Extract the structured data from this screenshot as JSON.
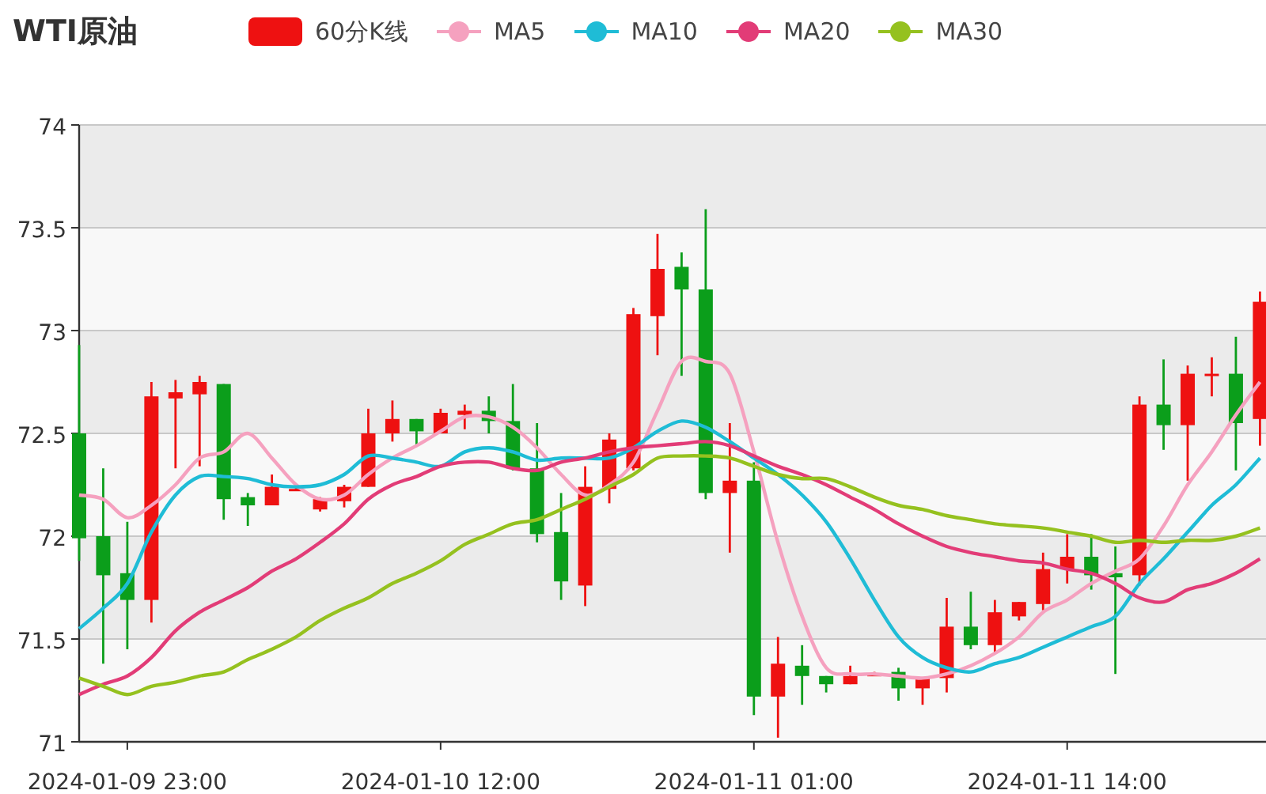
{
  "title": "WTI原油",
  "chart": {
    "candle_legend": {
      "label": "60分K线",
      "color": "#ee1111"
    },
    "candles": {
      "chart_data": {
        "type": "candlestick",
        "ylim": [
          71,
          74
        ],
        "grid": true,
        "yticks": [
          71,
          71.5,
          72,
          72.5,
          73,
          73.5,
          74
        ],
        "categories": [
          null,
          null,
          "2024-01-09 23:00",
          null,
          null,
          null,
          null,
          null,
          null,
          null,
          null,
          null,
          null,
          null,
          null,
          "2024-01-10 12:00",
          null,
          null,
          null,
          null,
          null,
          null,
          null,
          null,
          null,
          null,
          null,
          null,
          "2024-01-11 01:00",
          null,
          null,
          null,
          null,
          null,
          null,
          null,
          null,
          null,
          null,
          null,
          null,
          "2024-01-11 14:00",
          null,
          null,
          null,
          null,
          null,
          null,
          null,
          null
        ],
        "ohlc": [
          [
            72.5,
            72.93,
            71.88,
            71.99
          ],
          [
            72.0,
            72.33,
            71.38,
            71.81
          ],
          [
            71.82,
            72.07,
            71.45,
            71.69
          ],
          [
            71.69,
            72.75,
            71.58,
            72.68
          ],
          [
            72.67,
            72.76,
            72.33,
            72.7
          ],
          [
            72.69,
            72.78,
            72.34,
            72.75
          ],
          [
            72.74,
            72.74,
            72.08,
            72.18
          ],
          [
            72.19,
            72.21,
            72.05,
            72.15
          ],
          [
            72.15,
            72.3,
            72.15,
            72.24
          ],
          [
            72.23,
            72.24,
            72.22,
            72.23
          ],
          [
            72.13,
            72.19,
            72.12,
            72.18
          ],
          [
            72.17,
            72.25,
            72.14,
            72.24
          ],
          [
            72.24,
            72.62,
            72.24,
            72.5
          ],
          [
            72.5,
            72.66,
            72.46,
            72.57
          ],
          [
            72.57,
            72.57,
            72.44,
            72.51
          ],
          [
            72.5,
            72.62,
            72.5,
            72.6
          ],
          [
            72.59,
            72.64,
            72.52,
            72.61
          ],
          [
            72.61,
            72.68,
            72.5,
            72.56
          ],
          [
            72.56,
            72.74,
            72.32,
            72.33
          ],
          [
            72.33,
            72.55,
            71.97,
            72.01
          ],
          [
            72.02,
            72.21,
            71.69,
            71.78
          ],
          [
            71.76,
            72.34,
            71.66,
            72.24
          ],
          [
            72.23,
            72.5,
            72.16,
            72.47
          ],
          [
            72.33,
            73.11,
            72.32,
            73.08
          ],
          [
            73.07,
            73.47,
            72.88,
            73.3
          ],
          [
            73.31,
            73.38,
            72.78,
            73.2
          ],
          [
            73.2,
            73.59,
            72.18,
            72.21
          ],
          [
            72.21,
            72.55,
            71.92,
            72.27
          ],
          [
            72.27,
            72.36,
            71.13,
            71.22
          ],
          [
            71.22,
            71.51,
            71.02,
            71.38
          ],
          [
            71.37,
            71.47,
            71.18,
            71.32
          ],
          [
            71.32,
            71.32,
            71.24,
            71.28
          ],
          [
            71.28,
            71.37,
            71.28,
            71.32
          ],
          [
            71.33,
            71.34,
            71.32,
            71.33
          ],
          [
            71.34,
            71.36,
            71.2,
            71.26
          ],
          [
            71.26,
            71.31,
            71.18,
            71.31
          ],
          [
            71.31,
            71.7,
            71.24,
            71.56
          ],
          [
            71.56,
            71.73,
            71.45,
            71.47
          ],
          [
            71.47,
            71.69,
            71.43,
            71.63
          ],
          [
            71.61,
            71.68,
            71.59,
            71.68
          ],
          [
            71.67,
            71.92,
            71.64,
            71.84
          ],
          [
            71.84,
            72.01,
            71.77,
            71.9
          ],
          [
            71.9,
            72.01,
            71.74,
            71.81
          ],
          [
            71.82,
            71.95,
            71.33,
            71.8
          ],
          [
            71.81,
            72.68,
            71.76,
            72.64
          ],
          [
            72.64,
            72.86,
            72.42,
            72.54
          ],
          [
            72.54,
            72.83,
            72.27,
            72.79
          ],
          [
            72.79,
            72.87,
            72.68,
            72.79
          ],
          [
            72.79,
            72.97,
            72.32,
            72.55
          ],
          [
            72.57,
            73.19,
            72.44,
            73.14
          ]
        ]
      }
    },
    "moving_averages": {
      "chart_data": {
        "type": "line",
        "ylim": [
          71,
          74
        ],
        "series": [
          {
            "name": "MA5",
            "color": "#f5a1bf",
            "values": [
              72.2,
              72.18,
              72.09,
              72.15,
              72.25,
              72.38,
              72.41,
              72.5,
              72.38,
              72.25,
              72.18,
              72.2,
              72.3,
              72.38,
              72.44,
              72.51,
              72.58,
              72.58,
              72.53,
              72.43,
              72.3,
              72.2,
              72.25,
              72.36,
              72.61,
              72.85,
              72.85,
              72.79,
              72.41,
              71.97,
              71.61,
              71.36,
              71.33,
              71.33,
              71.32,
              71.31,
              71.33,
              71.37,
              71.43,
              71.51,
              71.63,
              71.69,
              71.77,
              71.83,
              71.89,
              72.05,
              72.25,
              72.41,
              72.59,
              72.75
            ]
          },
          {
            "name": "MA10",
            "color": "#1fbcd6",
            "values": [
              71.55,
              71.65,
              71.77,
              72.02,
              72.2,
              72.29,
              72.29,
              72.28,
              72.25,
              72.24,
              72.25,
              72.3,
              72.39,
              72.38,
              72.36,
              72.34,
              72.41,
              72.43,
              72.41,
              72.37,
              72.38,
              72.38,
              72.38,
              72.43,
              72.51,
              72.56,
              72.53,
              72.46,
              72.38,
              72.3,
              72.2,
              72.07,
              71.89,
              71.69,
              71.51,
              71.41,
              71.36,
              71.34,
              71.38,
              71.41,
              71.46,
              71.51,
              71.56,
              71.61,
              71.77,
              71.89,
              72.02,
              72.15,
              72.25,
              72.38
            ]
          },
          {
            "name": "MA20",
            "color": "#e23c77",
            "values": [
              71.23,
              71.28,
              71.32,
              71.41,
              71.54,
              71.63,
              71.69,
              71.75,
              71.83,
              71.89,
              71.97,
              72.06,
              72.18,
              72.25,
              72.29,
              72.34,
              72.36,
              72.36,
              72.33,
              72.32,
              72.36,
              72.38,
              72.41,
              72.43,
              72.44,
              72.45,
              72.46,
              72.44,
              72.39,
              72.34,
              72.3,
              72.25,
              72.19,
              72.13,
              72.06,
              72.0,
              71.95,
              71.92,
              71.9,
              71.88,
              71.87,
              71.84,
              71.82,
              71.77,
              71.7,
              71.68,
              71.74,
              71.77,
              71.82,
              71.89
            ]
          },
          {
            "name": "MA30",
            "color": "#95c11f",
            "values": [
              71.31,
              71.27,
              71.23,
              71.27,
              71.29,
              71.32,
              71.34,
              71.4,
              71.45,
              71.51,
              71.59,
              71.65,
              71.7,
              71.77,
              71.82,
              71.88,
              71.96,
              72.01,
              72.06,
              72.08,
              72.13,
              72.18,
              72.24,
              72.3,
              72.38,
              72.39,
              72.39,
              72.38,
              72.34,
              72.3,
              72.28,
              72.28,
              72.24,
              72.19,
              72.15,
              72.13,
              72.1,
              72.08,
              72.06,
              72.05,
              72.04,
              72.02,
              72.0,
              71.97,
              71.98,
              71.97,
              71.98,
              71.98,
              72.0,
              72.04
            ]
          }
        ]
      }
    }
  }
}
